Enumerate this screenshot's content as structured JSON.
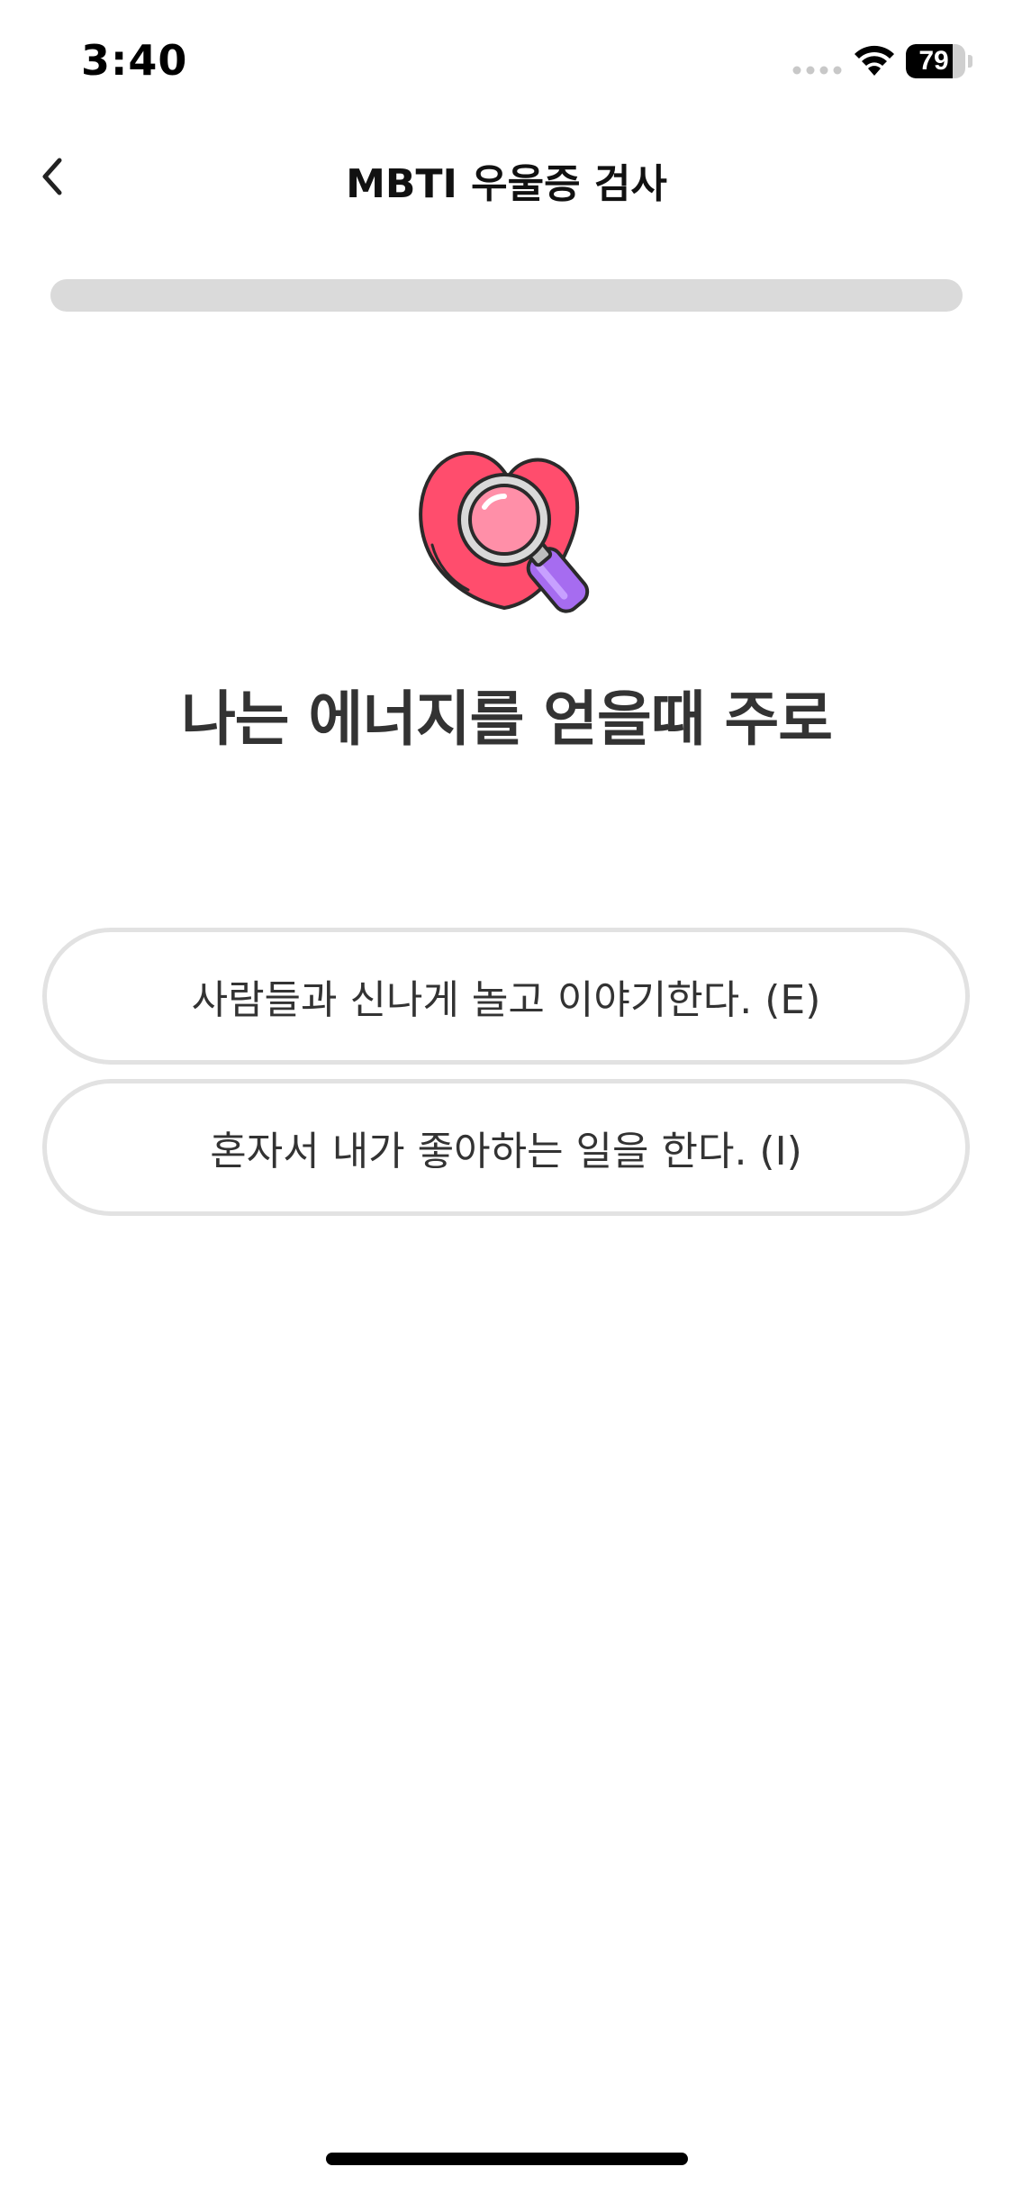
{
  "status_bar": {
    "time": "3:40",
    "battery_level": "79",
    "battery_fraction": 0.79,
    "icons": [
      "signal-dots-icon",
      "wifi-icon",
      "battery-icon"
    ]
  },
  "header": {
    "title": "MBTI 우울증 검사",
    "back_icon": "chevron-left-icon"
  },
  "progress": {
    "fraction": 0
  },
  "illustration": {
    "icon": "heart-magnifier-icon",
    "colors": {
      "heart": "#ff4d6d",
      "lens": "#ff8fa8",
      "handle": "#a66cf0"
    }
  },
  "question": {
    "text": "나는 에너지를 얻을때 주로"
  },
  "answers": [
    {
      "label": "사람들과 신나게 놀고 이야기한다. (E)"
    },
    {
      "label": "혼자서 내가 좋아하는 일을 한다. (I)"
    }
  ]
}
